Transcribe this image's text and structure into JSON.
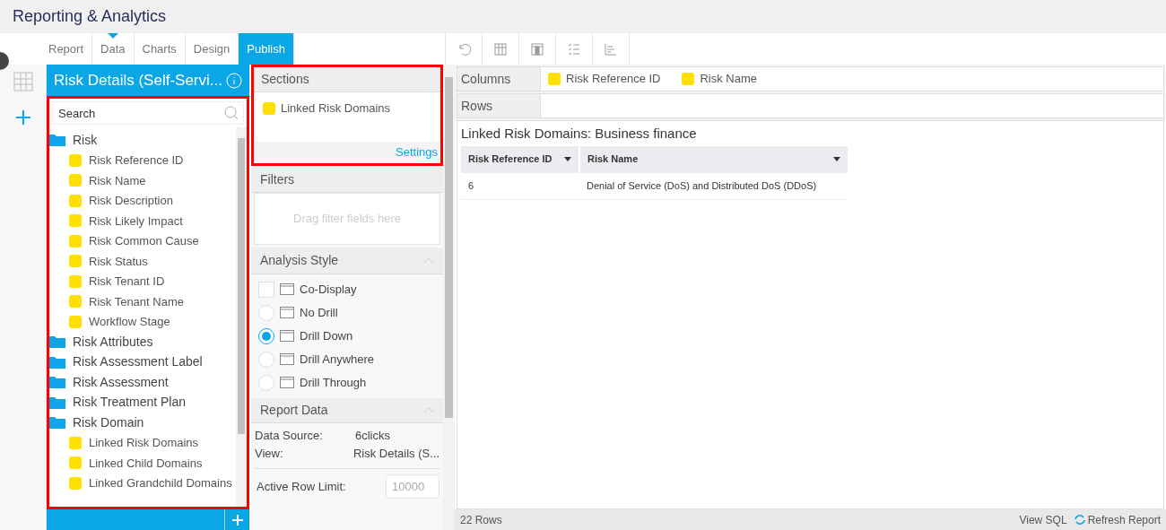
{
  "app_title": "Reporting & Analytics",
  "tabs": [
    {
      "label": "Report",
      "selected": false
    },
    {
      "label": "Data",
      "selected": false,
      "marker": true
    },
    {
      "label": "Charts",
      "selected": false
    },
    {
      "label": "Design",
      "selected": false
    },
    {
      "label": "Publish",
      "selected": true
    }
  ],
  "field_panel": {
    "title": "Risk Details (Self-Servi...",
    "search": {
      "placeholder": "Search"
    },
    "tree": [
      {
        "kind": "folder",
        "label": "Risk",
        "children": [
          {
            "kind": "field",
            "label": "Risk Reference ID"
          },
          {
            "kind": "field",
            "label": "Risk Name"
          },
          {
            "kind": "field",
            "label": "Risk Description"
          },
          {
            "kind": "field",
            "label": "Risk Likely Impact"
          },
          {
            "kind": "field",
            "label": "Risk Common Cause"
          },
          {
            "kind": "field",
            "label": "Risk Status"
          },
          {
            "kind": "field",
            "label": "Risk Tenant ID"
          },
          {
            "kind": "field",
            "label": "Risk Tenant Name"
          },
          {
            "kind": "field",
            "label": "Workflow Stage"
          }
        ]
      },
      {
        "kind": "folder",
        "label": "Risk Attributes"
      },
      {
        "kind": "folder",
        "label": "Risk Assessment Label"
      },
      {
        "kind": "folder",
        "label": "Risk Assessment"
      },
      {
        "kind": "folder",
        "label": "Risk Treatment Plan"
      },
      {
        "kind": "folder",
        "label": "Risk Domain",
        "children": [
          {
            "kind": "field",
            "label": "Linked Risk Domains"
          },
          {
            "kind": "field",
            "label": "Linked Child Domains"
          },
          {
            "kind": "field",
            "label": "Linked Grandchild Domains"
          }
        ]
      }
    ]
  },
  "sections": {
    "title": "Sections",
    "items": [
      "Linked Risk Domains"
    ],
    "settings_link": "Settings"
  },
  "filters": {
    "title": "Filters",
    "placeholder": "Drag filter fields here"
  },
  "analysis_style": {
    "title": "Analysis Style",
    "options": [
      {
        "kind": "checkbox",
        "label": "Co-Display",
        "checked": false
      },
      {
        "kind": "radio",
        "label": "No Drill",
        "selected": false
      },
      {
        "kind": "radio",
        "label": "Drill Down",
        "selected": true
      },
      {
        "kind": "radio",
        "label": "Drill Anywhere",
        "selected": false
      },
      {
        "kind": "radio",
        "label": "Drill Through",
        "selected": false
      }
    ]
  },
  "report_data": {
    "title": "Report Data",
    "rows": [
      {
        "label": "Data Source:",
        "value": "6clicks"
      },
      {
        "label": "View:",
        "value": "Risk Details (S..."
      }
    ],
    "row_limit": {
      "label": "Active Row Limit:",
      "placeholder": "10000"
    }
  },
  "columns_shelf": {
    "label": "Columns",
    "items": [
      "Risk Reference ID",
      "Risk Name"
    ]
  },
  "rows_shelf": {
    "label": "Rows"
  },
  "report": {
    "section_title": "Linked Risk Domains: Business finance",
    "columns": [
      "Risk Reference ID",
      "Risk Name"
    ],
    "rows": [
      [
        "6",
        "Denial of Service (DoS) and Distributed DoS (DDoS)"
      ]
    ]
  },
  "status_bar": {
    "row_count": "22 Rows",
    "view_sql": "View SQL",
    "refresh": "Refresh Report"
  }
}
